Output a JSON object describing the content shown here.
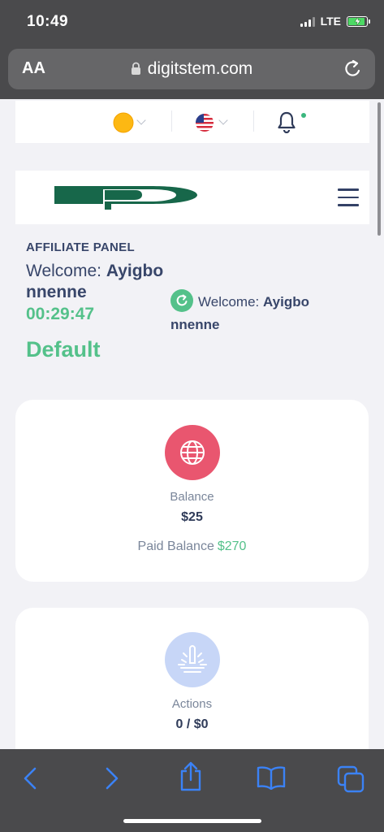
{
  "status_bar": {
    "time": "10:49",
    "network": "LTE",
    "battery_level": 0.85,
    "battery_charging": true
  },
  "browser": {
    "aa_label": "AA",
    "url": "digitstem.com",
    "icons": [
      "lock-icon",
      "reload-icon"
    ]
  },
  "site_header": {
    "icons": [
      "sun-icon",
      "flag-icon",
      "bell-icon",
      "menu-icon"
    ],
    "notification_dot_color": "#3bb77e"
  },
  "affiliate": {
    "panel_title": "AFFILIATE PANEL",
    "welcome_prefix": "Welcome:",
    "welcome_name_line1": "Ayigbo",
    "welcome_name_line2": "nnenne",
    "timer": "00:29:47",
    "secondary_welcome_prefix": "Welcome:",
    "secondary_welcome_name_line1": "Ayigbo",
    "secondary_welcome_name_line2": "nnenne",
    "plan": "Default"
  },
  "cards": {
    "balance": {
      "icon": "globe-icon",
      "label": "Balance",
      "value": "$25",
      "paid_label": "Paid Balance",
      "paid_value": "$270"
    },
    "actions": {
      "icon": "fountain-icon",
      "label": "Actions",
      "value": "0 / $0"
    }
  },
  "toolbar": {
    "icons": [
      "back-icon",
      "forward-icon",
      "share-icon",
      "bookmarks-icon",
      "tabs-icon"
    ]
  },
  "colors": {
    "accent_green": "#54c18a",
    "text_navy": "#38466a",
    "balance_red": "#e9566f",
    "ios_blue": "#3b82f6"
  }
}
